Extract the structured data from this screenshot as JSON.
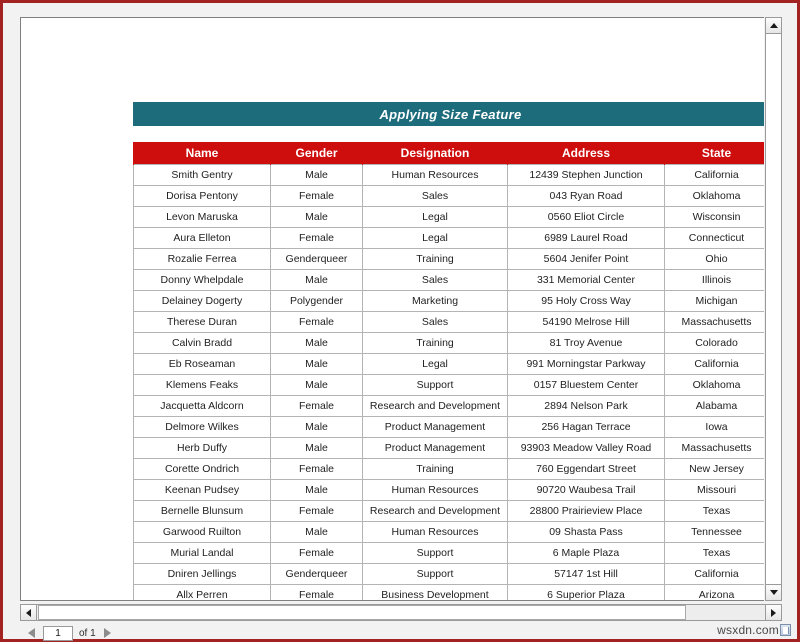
{
  "report": {
    "title": "Applying Size Feature",
    "columns": [
      "Name",
      "Gender",
      "Designation",
      "Address",
      "State"
    ],
    "rows": [
      [
        "Smith Gentry",
        "Male",
        "Human Resources",
        "12439 Stephen Junction",
        "California"
      ],
      [
        "Dorisa Pentony",
        "Female",
        "Sales",
        "043 Ryan Road",
        "Oklahoma"
      ],
      [
        "Levon Maruska",
        "Male",
        "Legal",
        "0560 Eliot Circle",
        "Wisconsin"
      ],
      [
        "Aura Elleton",
        "Female",
        "Legal",
        "6989 Laurel Road",
        "Connecticut"
      ],
      [
        "Rozalie Ferrea",
        "Genderqueer",
        "Training",
        "5604 Jenifer Point",
        "Ohio"
      ],
      [
        "Donny Whelpdale",
        "Male",
        "Sales",
        "331 Memorial Center",
        "Illinois"
      ],
      [
        "Delainey Dogerty",
        "Polygender",
        "Marketing",
        "95 Holy Cross Way",
        "Michigan"
      ],
      [
        "Therese Duran",
        "Female",
        "Sales",
        "54190 Melrose Hill",
        "Massachusetts"
      ],
      [
        "Calvin Bradd",
        "Male",
        "Training",
        "81 Troy Avenue",
        "Colorado"
      ],
      [
        "Eb Roseaman",
        "Male",
        "Legal",
        "991 Morningstar Parkway",
        "California"
      ],
      [
        "Klemens Feaks",
        "Male",
        "Support",
        "0157 Bluestem Center",
        "Oklahoma"
      ],
      [
        "Jacquetta Aldcorn",
        "Female",
        "Research and Development",
        "2894 Nelson Park",
        "Alabama"
      ],
      [
        "Delmore Wilkes",
        "Male",
        "Product Management",
        "256 Hagan Terrace",
        "Iowa"
      ],
      [
        "Herb Duffy",
        "Male",
        "Product Management",
        "93903 Meadow Valley Road",
        "Massachusetts"
      ],
      [
        "Corette Ondrich",
        "Female",
        "Training",
        "760 Eggendart Street",
        "New Jersey"
      ],
      [
        "Keenan Pudsey",
        "Male",
        "Human Resources",
        "90720 Waubesa Trail",
        "Missouri"
      ],
      [
        "Bernelle Blunsum",
        "Female",
        "Research and Development",
        "28800 Prairieview Place",
        "Texas"
      ],
      [
        "Garwood Ruilton",
        "Male",
        "Human Resources",
        "09 Shasta Pass",
        "Tennessee"
      ],
      [
        "Murial Landal",
        "Female",
        "Support",
        "6 Maple Plaza",
        "Texas"
      ],
      [
        "Dniren Jellings",
        "Genderqueer",
        "Support",
        "57147 1st Hill",
        "California"
      ],
      [
        "Allx Perren",
        "Female",
        "Business Development",
        "6 Superior Plaza",
        "Arizona"
      ]
    ]
  },
  "pager": {
    "current_page": "1",
    "total_label": "of 1"
  },
  "watermark": {
    "text": "wsxdn.com"
  },
  "colors": {
    "title_bar": "#1d6c7c",
    "header_row": "#ce0d0d",
    "frame_border": "#a32222",
    "cell_border": "#b4b4b4"
  }
}
